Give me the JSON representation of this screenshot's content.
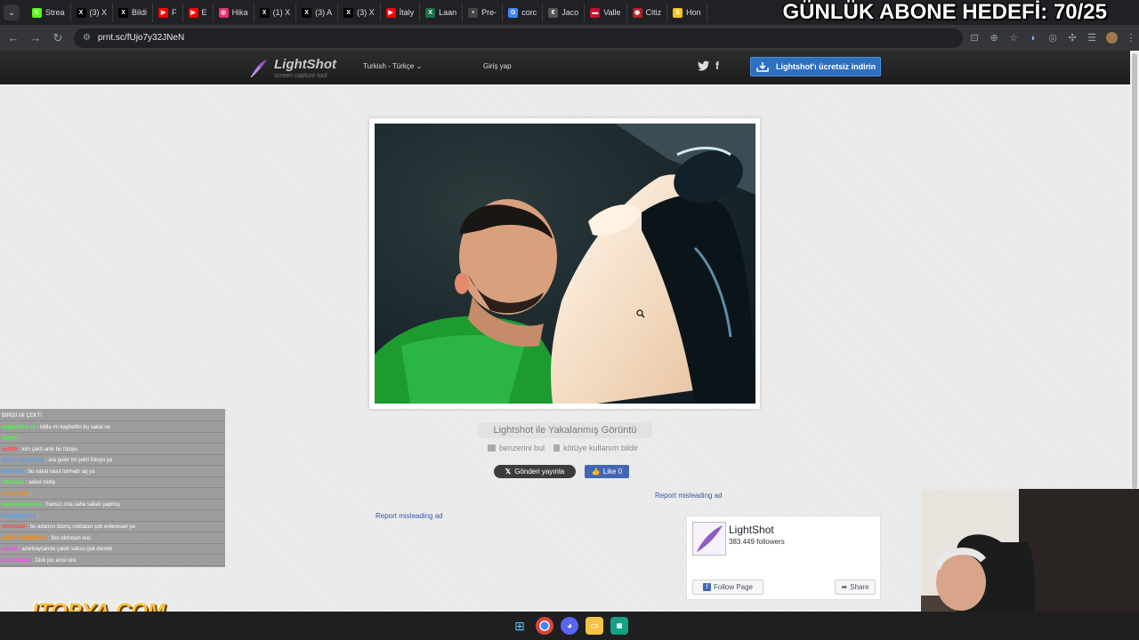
{
  "browser": {
    "tabs": [
      {
        "label": "Strea",
        "favicon": "K",
        "color": "#53fc18"
      },
      {
        "label": "(3) X",
        "favicon": "X",
        "color": "#000000"
      },
      {
        "label": "Bildi",
        "favicon": "X",
        "color": "#000000"
      },
      {
        "label": "F",
        "favicon": "▶",
        "color": "#ff0000"
      },
      {
        "label": "E",
        "favicon": "▶",
        "color": "#ff0000"
      },
      {
        "label": "Hika",
        "favicon": "◎",
        "color": "#e1306c"
      },
      {
        "label": "(1) X",
        "favicon": "X",
        "color": "#000000"
      },
      {
        "label": "(3) A",
        "favicon": "X",
        "color": "#000000"
      },
      {
        "label": "(3) X",
        "favicon": "X",
        "color": "#000000"
      },
      {
        "label": "İtaly",
        "favicon": "▶",
        "color": "#ff0000"
      },
      {
        "label": "Laan",
        "favicon": "X",
        "color": "#1e7145"
      },
      {
        "label": "Pre-",
        "favicon": "•",
        "color": "#444444"
      },
      {
        "label": "corc",
        "favicon": "G",
        "color": "#4285f4"
      },
      {
        "label": "Jaco",
        "favicon": "€",
        "color": "#555555"
      },
      {
        "label": "Valle",
        "favicon": "▬",
        "color": "#c8102e"
      },
      {
        "label": "Citiz",
        "favicon": "◉",
        "color": "#b22222"
      },
      {
        "label": "Hon",
        "favicon": "S",
        "color": "#f5c518"
      }
    ],
    "url": "prnt.sc/fUjo7y32JNeN"
  },
  "stream_overlay": {
    "goal_text": "GÜNLÜK ABONE HEDEFİ: 70/25",
    "sponsor_logo": "ITOPYA.COM"
  },
  "site": {
    "logo_name": "LightShot",
    "logo_tagline": "screen capture tool",
    "language": "Turkish - Türkçe",
    "login": "Giriş yap",
    "download_button": "Lightshot'ı ücretsiz indirin"
  },
  "screenshot": {
    "caption": "Lightshot ile Yakalanmış Görüntü",
    "find_similar": "benzerini bul",
    "report_abuse": "kötüye kullanım bildir",
    "post_button": "Gönderi yayınla",
    "like_button": "Like 0",
    "report_ad_1": "Report misleading ad",
    "report_ad_2": "Report misleading ad"
  },
  "fb_widget": {
    "page_name": "LightShot",
    "followers": "383.449 followers",
    "follow_button": "Follow Page",
    "share_button": "Share"
  },
  "chat": [
    {
      "user": "",
      "text": "BİRİSİ Mİ ÇEKTİ",
      "color": "#ffffff"
    },
    {
      "user": "ozgurmert_m",
      "text": ": iddia mı kaybettin bu sakal ne",
      "color": "#44ff44"
    },
    {
      "user": "Apeyc",
      "text": ":",
      "color": "#44ff44"
    },
    {
      "user": "cellt0r",
      "text": ": kim çekti amk bu fotoyu",
      "color": "#ff4444"
    },
    {
      "user": "Sokut_Lightning",
      "text": ": ara guler mi çekti fotoyu ya",
      "color": "#4aa0ff"
    },
    {
      "user": "berkin03",
      "text": ": bu sakal nasıl tutmadı aq ya",
      "color": "#4aa0ff"
    },
    {
      "user": "umresan",
      "text": ": sakal mutiş",
      "color": "#44ff44"
    },
    {
      "user": "muratmrta",
      "text": ":",
      "color": "#ff8c00"
    },
    {
      "user": "warmachinesss",
      "text": ": fransız orta saha sakalı yapmış",
      "color": "#44ff44"
    },
    {
      "user": "Flackpeker17",
      "text": ":",
      "color": "#4aa0ff"
    },
    {
      "user": "okrecslar",
      "text": ": bu adamın özenç noktaları çok enteresan ya",
      "color": "#ff4444"
    },
    {
      "user": "ASTROTHUNDER",
      "text": ": film bitmesin reis",
      "color": "#ff8c00"
    },
    {
      "user": "noeak",
      "text": ": azerbaycanda çaldır sakso çek demek",
      "color": "#ff44ff"
    },
    {
      "user": "bodzyburry",
      "text": ": Dick pic acisi reis",
      "color": "#ff44ff"
    }
  ]
}
